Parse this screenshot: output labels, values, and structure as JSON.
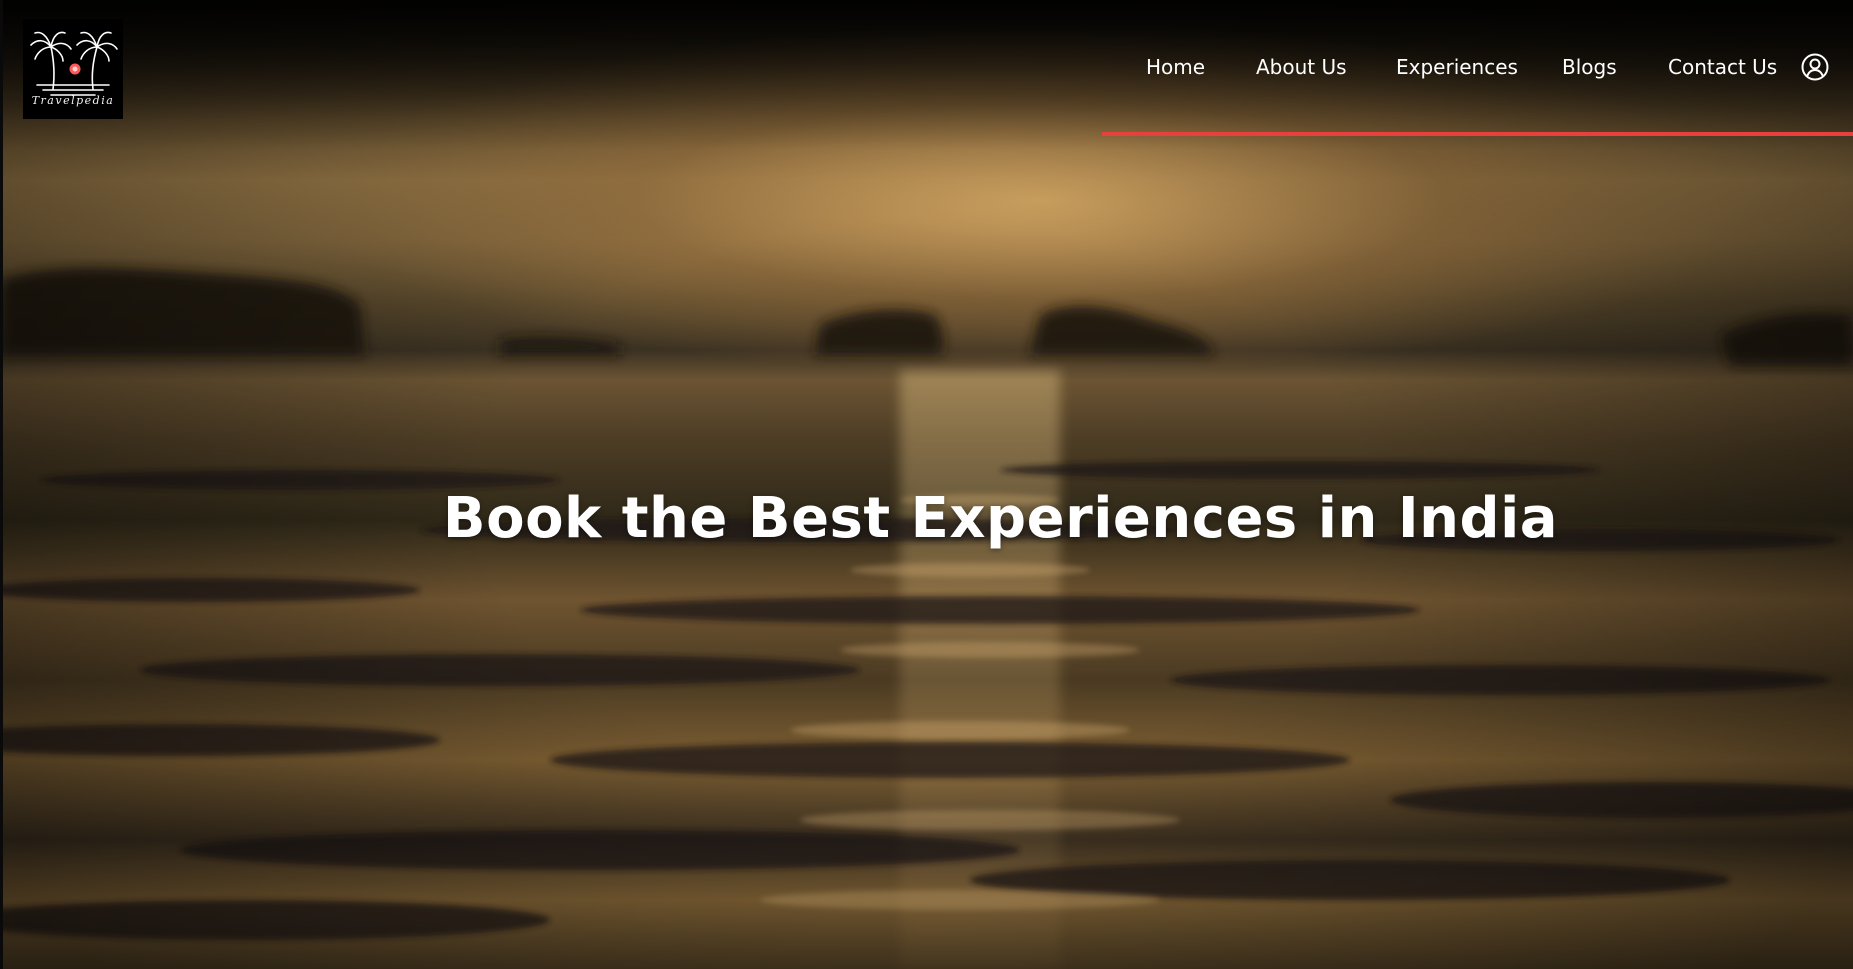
{
  "brand": {
    "logo_text": "Travelpedia"
  },
  "nav": {
    "items": [
      {
        "label": "Home"
      },
      {
        "label": "About Us"
      },
      {
        "label": "Experiences"
      },
      {
        "label": "Blogs"
      },
      {
        "label": "Contact Us"
      }
    ],
    "account_icon": "user-circle-icon",
    "accent_color": "#e8403c"
  },
  "hero": {
    "title": "Book the Best Experiences in India",
    "background": "sunset over water (blurred photograph)"
  }
}
